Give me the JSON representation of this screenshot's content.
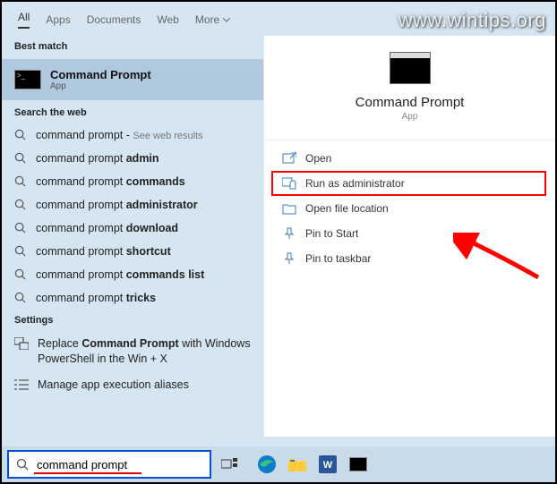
{
  "watermark": "www.wintips.org",
  "tabs": {
    "all": "All",
    "apps": "Apps",
    "documents": "Documents",
    "web": "Web",
    "more": "More"
  },
  "sections": {
    "best_match": "Best match",
    "search_web": "Search the web",
    "settings": "Settings"
  },
  "best_match": {
    "title": "Command Prompt",
    "subtitle": "App"
  },
  "web_items": [
    {
      "prefix": "command prompt",
      "bold": "",
      "suffix": " - ",
      "see": "See web results"
    },
    {
      "prefix": "command prompt ",
      "bold": "admin",
      "suffix": "",
      "see": ""
    },
    {
      "prefix": "command prompt ",
      "bold": "commands",
      "suffix": "",
      "see": ""
    },
    {
      "prefix": "command prompt ",
      "bold": "administrator",
      "suffix": "",
      "see": ""
    },
    {
      "prefix": "command prompt ",
      "bold": "download",
      "suffix": "",
      "see": ""
    },
    {
      "prefix": "command prompt ",
      "bold": "shortcut",
      "suffix": "",
      "see": ""
    },
    {
      "prefix": "command prompt ",
      "bold": "commands list",
      "suffix": "",
      "see": ""
    },
    {
      "prefix": "command prompt ",
      "bold": "tricks",
      "suffix": "",
      "see": ""
    }
  ],
  "settings_items": [
    {
      "icon": "swap-icon",
      "html": "Replace <b>Command Prompt</b> with Windows PowerShell in the Win + X"
    },
    {
      "icon": "list-icon",
      "html": "Manage app execution aliases"
    }
  ],
  "preview": {
    "title": "Command Prompt",
    "subtitle": "App"
  },
  "actions": [
    {
      "icon": "open-icon",
      "label": "Open",
      "hl": false
    },
    {
      "icon": "admin-icon",
      "label": "Run as administrator",
      "hl": true
    },
    {
      "icon": "folder-icon",
      "label": "Open file location",
      "hl": false
    },
    {
      "icon": "pin-start-icon",
      "label": "Pin to Start",
      "hl": false
    },
    {
      "icon": "pin-taskbar-icon",
      "label": "Pin to taskbar",
      "hl": false
    }
  ],
  "search": {
    "value": "command prompt"
  }
}
